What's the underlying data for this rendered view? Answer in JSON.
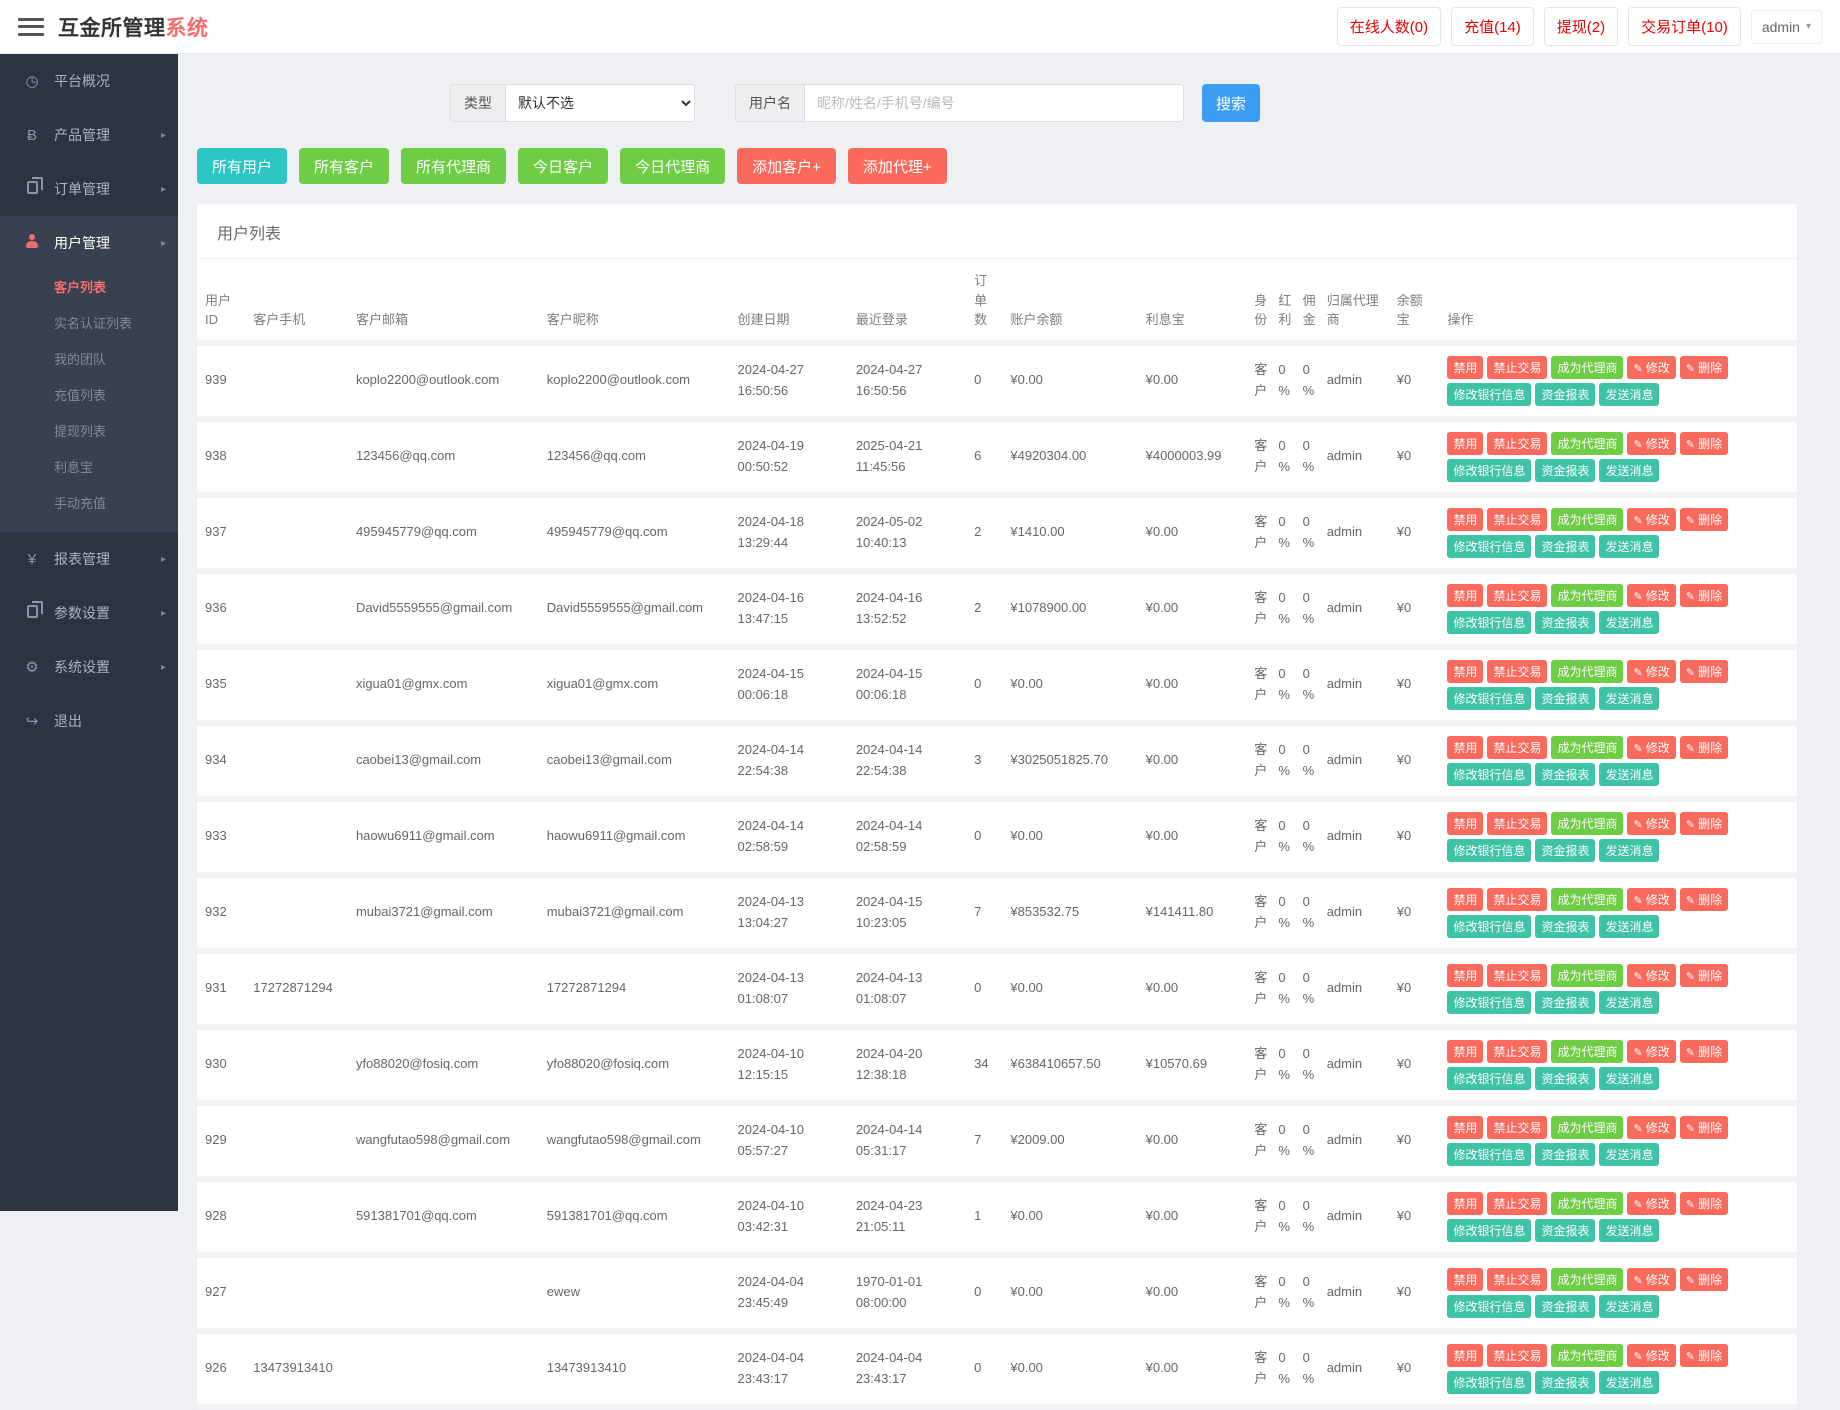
{
  "colors": {
    "accent_red": "#f56c6c",
    "money_red": "#e60000",
    "badge_red": "#e60000",
    "teal_button": "#2cc6c3",
    "green_button": "#6fcc45",
    "salmon_button": "#f9695c",
    "teal_small_button": "#3ec3a7",
    "search_blue": "#3d9df5",
    "sidebar_bg": "#2d3441",
    "sidebar_group_bg": "#39404f"
  },
  "header": {
    "title_main": "互金所管理",
    "title_accent": "系统",
    "badges": [
      "在线人数(0)",
      "充值(14)",
      "提现(2)",
      "交易订单(10)"
    ],
    "user": "admin",
    "caret_icon": "▾"
  },
  "sidebar": {
    "overview": "平台概况",
    "product": "产品管理",
    "order": "订单管理",
    "user": "用户管理",
    "submenu": [
      "客户列表",
      "实名认证列表",
      "我的团队",
      "充值列表",
      "提现列表",
      "利息宝",
      "手动充值"
    ],
    "report": "报表管理",
    "params": "参数设置",
    "system": "系统设置",
    "logout": "退出",
    "arrow_icon": "▸",
    "gauge_icon": "◷",
    "bitcoin_icon": "Ƀ",
    "yen_icon": "¥",
    "gear_icon": "⚙",
    "logout_icon": "↪"
  },
  "filters": {
    "type_label": "类型",
    "type_value": "默认不选",
    "username_label": "用户名",
    "username_placeholder": "昵称/姓名/手机号/编号",
    "search_label": "搜索"
  },
  "quick_buttons": [
    "所有用户",
    "所有客户",
    "所有代理商",
    "今日客户",
    "今日代理商",
    "添加客户+",
    "添加代理+"
  ],
  "table": {
    "title": "用户列表",
    "columns": [
      "用户ID",
      "客户手机",
      "客户邮箱",
      "客户昵称",
      "创建日期",
      "最近登录",
      "订单数",
      "账户余额",
      "利息宝",
      "身份",
      "红利",
      "佣金",
      "归属代理商",
      "余额宝",
      "操作"
    ],
    "row_actions": {
      "disable": "禁用",
      "ban_trade": "禁止交易",
      "become_agent": "成为代理商",
      "edit": "修改",
      "delete": "删除",
      "edit_bank": "修改银行信息",
      "fund_report": "资金报表",
      "send_message": "发送消息"
    },
    "rows": [
      {
        "id": "939",
        "phone": "",
        "email": "koplo2200@outlook.com",
        "nickname": "koplo2200@outlook.com",
        "created": "2024-04-27 16:50:56",
        "last_login": "2024-04-27 16:50:56",
        "orders": "0",
        "balance": "¥0.00",
        "interest": "¥0.00",
        "identity": "客户",
        "bonus": "0%",
        "commission": "0%",
        "agent": "admin",
        "yuebao": "¥0"
      },
      {
        "id": "938",
        "phone": "",
        "email": "123456@qq.com",
        "nickname": "123456@qq.com",
        "created": "2024-04-19 00:50:52",
        "last_login": "2025-04-21 11:45:56",
        "orders": "6",
        "balance": "¥4920304.00",
        "interest": "¥4000003.99",
        "identity": "客户",
        "bonus": "0%",
        "commission": "0%",
        "agent": "admin",
        "yuebao": "¥0"
      },
      {
        "id": "937",
        "phone": "",
        "email": "495945779@qq.com",
        "nickname": "495945779@qq.com",
        "created": "2024-04-18 13:29:44",
        "last_login": "2024-05-02 10:40:13",
        "orders": "2",
        "balance": "¥1410.00",
        "interest": "¥0.00",
        "identity": "客户",
        "bonus": "0%",
        "commission": "0%",
        "agent": "admin",
        "yuebao": "¥0"
      },
      {
        "id": "936",
        "phone": "",
        "email": "David5559555@gmail.com",
        "nickname": "David5559555@gmail.com",
        "created": "2024-04-16 13:47:15",
        "last_login": "2024-04-16 13:52:52",
        "orders": "2",
        "balance": "¥1078900.00",
        "interest": "¥0.00",
        "identity": "客户",
        "bonus": "0%",
        "commission": "0%",
        "agent": "admin",
        "yuebao": "¥0"
      },
      {
        "id": "935",
        "phone": "",
        "email": "xigua01@gmx.com",
        "nickname": "xigua01@gmx.com",
        "created": "2024-04-15 00:06:18",
        "last_login": "2024-04-15 00:06:18",
        "orders": "0",
        "balance": "¥0.00",
        "interest": "¥0.00",
        "identity": "客户",
        "bonus": "0%",
        "commission": "0%",
        "agent": "admin",
        "yuebao": "¥0"
      },
      {
        "id": "934",
        "phone": "",
        "email": "caobei13@gmail.com",
        "nickname": "caobei13@gmail.com",
        "created": "2024-04-14 22:54:38",
        "last_login": "2024-04-14 22:54:38",
        "orders": "3",
        "balance": "¥3025051825.70",
        "interest": "¥0.00",
        "identity": "客户",
        "bonus": "0%",
        "commission": "0%",
        "agent": "admin",
        "yuebao": "¥0"
      },
      {
        "id": "933",
        "phone": "",
        "email": "haowu6911@gmail.com",
        "nickname": "haowu6911@gmail.com",
        "created": "2024-04-14 02:58:59",
        "last_login": "2024-04-14 02:58:59",
        "orders": "0",
        "balance": "¥0.00",
        "interest": "¥0.00",
        "identity": "客户",
        "bonus": "0%",
        "commission": "0%",
        "agent": "admin",
        "yuebao": "¥0"
      },
      {
        "id": "932",
        "phone": "",
        "email": "mubai3721@gmail.com",
        "nickname": "mubai3721@gmail.com",
        "created": "2024-04-13 13:04:27",
        "last_login": "2024-04-15 10:23:05",
        "orders": "7",
        "balance": "¥853532.75",
        "interest": "¥141411.80",
        "identity": "客户",
        "bonus": "0%",
        "commission": "0%",
        "agent": "admin",
        "yuebao": "¥0"
      },
      {
        "id": "931",
        "phone": "17272871294",
        "email": "",
        "nickname": "17272871294",
        "created": "2024-04-13 01:08:07",
        "last_login": "2024-04-13 01:08:07",
        "orders": "0",
        "balance": "¥0.00",
        "interest": "¥0.00",
        "identity": "客户",
        "bonus": "0%",
        "commission": "0%",
        "agent": "admin",
        "yuebao": "¥0"
      },
      {
        "id": "930",
        "phone": "",
        "email": "yfo88020@fosiq.com",
        "nickname": "yfo88020@fosiq.com",
        "created": "2024-04-10 12:15:15",
        "last_login": "2024-04-20 12:38:18",
        "orders": "34",
        "balance": "¥638410657.50",
        "interest": "¥10570.69",
        "identity": "客户",
        "bonus": "0%",
        "commission": "0%",
        "agent": "admin",
        "yuebao": "¥0"
      },
      {
        "id": "929",
        "phone": "",
        "email": "wangfutao598@gmail.com",
        "nickname": "wangfutao598@gmail.com",
        "created": "2024-04-10 05:57:27",
        "last_login": "2024-04-14 05:31:17",
        "orders": "7",
        "balance": "¥2009.00",
        "interest": "¥0.00",
        "identity": "客户",
        "bonus": "0%",
        "commission": "0%",
        "agent": "admin",
        "yuebao": "¥0"
      },
      {
        "id": "928",
        "phone": "",
        "email": "591381701@qq.com",
        "nickname": "591381701@qq.com",
        "created": "2024-04-10 03:42:31",
        "last_login": "2024-04-23 21:05:11",
        "orders": "1",
        "balance": "¥0.00",
        "interest": "¥0.00",
        "identity": "客户",
        "bonus": "0%",
        "commission": "0%",
        "agent": "admin",
        "yuebao": "¥0"
      },
      {
        "id": "927",
        "phone": "",
        "email": "",
        "nickname": "ewew",
        "created": "2024-04-04 23:45:49",
        "last_login": "1970-01-01 08:00:00",
        "orders": "0",
        "balance": "¥0.00",
        "interest": "¥0.00",
        "identity": "客户",
        "bonus": "0%",
        "commission": "0%",
        "agent": "admin",
        "yuebao": "¥0"
      },
      {
        "id": "926",
        "phone": "13473913410",
        "email": "",
        "nickname": "13473913410",
        "created": "2024-04-04 23:43:17",
        "last_login": "2024-04-04 23:43:17",
        "orders": "0",
        "balance": "¥0.00",
        "interest": "¥0.00",
        "identity": "客户",
        "bonus": "0%",
        "commission": "0%",
        "agent": "admin",
        "yuebao": "¥0"
      }
    ]
  }
}
